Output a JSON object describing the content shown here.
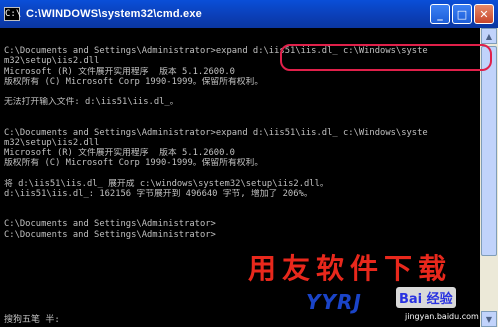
{
  "window": {
    "title": "C:\\WINDOWS\\system32\\cmd.exe",
    "min_label": "_",
    "max_label": "□",
    "close_label": "✕"
  },
  "console": {
    "lines": [
      "",
      "C:\\Documents and Settings\\Administrator>expand d:\\iis51\\iis.dl_ c:\\Windows\\syste",
      "m32\\setup\\iis2.dll",
      "Microsoft (R) 文件展开实用程序  版本 5.1.2600.0",
      "版权所有 (C) Microsoft Corp 1990-1999。保留所有权利。",
      "",
      "无法打开输入文件: d:\\iis51\\iis.dl_。",
      "",
      "",
      "C:\\Documents and Settings\\Administrator>expand d:\\iis51\\iis.dl_ c:\\Windows\\syste",
      "m32\\setup\\iis2.dll",
      "Microsoft (R) 文件展开实用程序  版本 5.1.2600.0",
      "版权所有 (C) Microsoft Corp 1990-1999。保留所有权利。",
      "",
      "将 d:\\iis51\\iis.dl_ 展开成 c:\\windows\\system32\\setup\\iis2.dll。",
      "d:\\iis51\\iis.dl_: 162156 字节展开到 496640 字节, 增加了 206%。",
      "",
      "",
      "C:\\Documents and Settings\\Administrator>",
      "C:\\Documents and Settings\\Administrator>"
    ],
    "ime_status": "搜狗五笔 半:"
  },
  "watermark": {
    "chinese": "用友软件下载",
    "latin": "YYRJ",
    "badge": "Bai 经验",
    "url": "jingyan.baidu.com"
  },
  "colors": {
    "titlebar": "#0b3fb8",
    "console_bg": "#000000",
    "console_text": "#c0c0c0",
    "highlight": "#e0204a",
    "watermark_red": "#e8281c",
    "watermark_blue": "#1a44c8"
  }
}
